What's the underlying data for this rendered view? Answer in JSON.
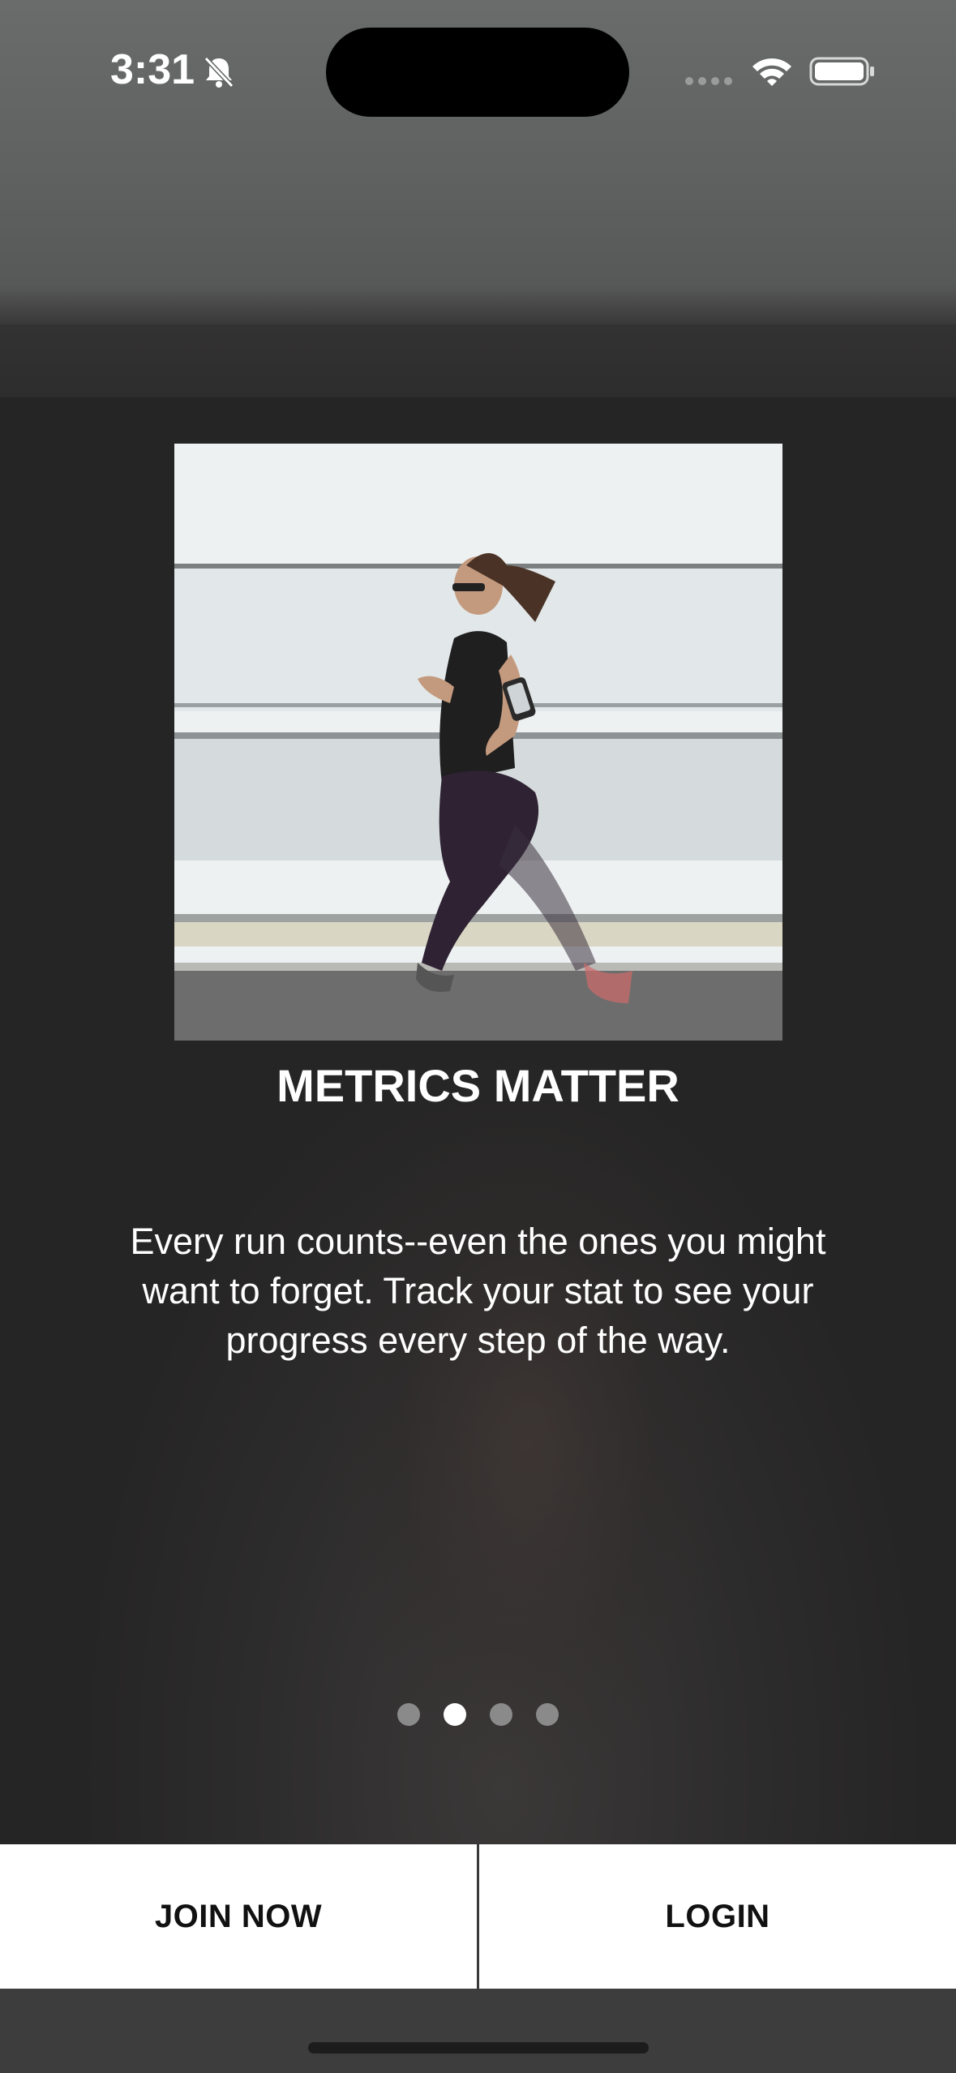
{
  "status_bar": {
    "time": "3:31"
  },
  "onboarding": {
    "title": "METRICS MATTER",
    "description": "Every run counts--even the ones you might want to forget. Track your stat to see your progress every step of the way.",
    "page_indicator": {
      "total": 4,
      "current": 2
    }
  },
  "actions": {
    "join_label": "JOIN NOW",
    "login_label": "LOGIN"
  },
  "colors": {
    "button_bg": "#ffffff",
    "button_text": "#111111",
    "dot_active": "#ffffff",
    "dot_inactive": "#8a8a8a"
  }
}
